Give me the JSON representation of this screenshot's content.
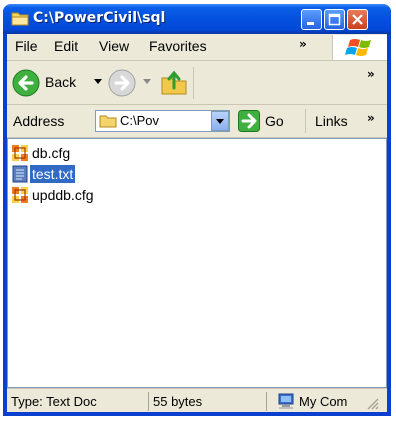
{
  "window": {
    "title": "C:\\PowerCivil\\sql"
  },
  "menubar": {
    "items": [
      "File",
      "Edit",
      "View",
      "Favorites"
    ],
    "more": "»"
  },
  "toolbar": {
    "back_label": "Back",
    "more": "»"
  },
  "addressbar": {
    "label": "Address",
    "value": "C:\\PowerCivil\\sql",
    "visible_value": "C:\\Pov",
    "go_label": "Go",
    "links_label": "Links",
    "links_more": "»"
  },
  "files": [
    {
      "name": "db.cfg",
      "icon": "cfg-file-icon",
      "selected": false
    },
    {
      "name": "test.txt",
      "icon": "text-file-icon",
      "selected": true
    },
    {
      "name": "upddb.cfg",
      "icon": "cfg-file-icon",
      "selected": false
    }
  ],
  "statusbar": {
    "type_text": "Type: Text Doc",
    "size_text": "55 bytes",
    "zone_text": "My Com"
  },
  "colors": {
    "titlebar": "#0550df",
    "selection": "#316ac5",
    "chrome": "#ece9d8"
  }
}
